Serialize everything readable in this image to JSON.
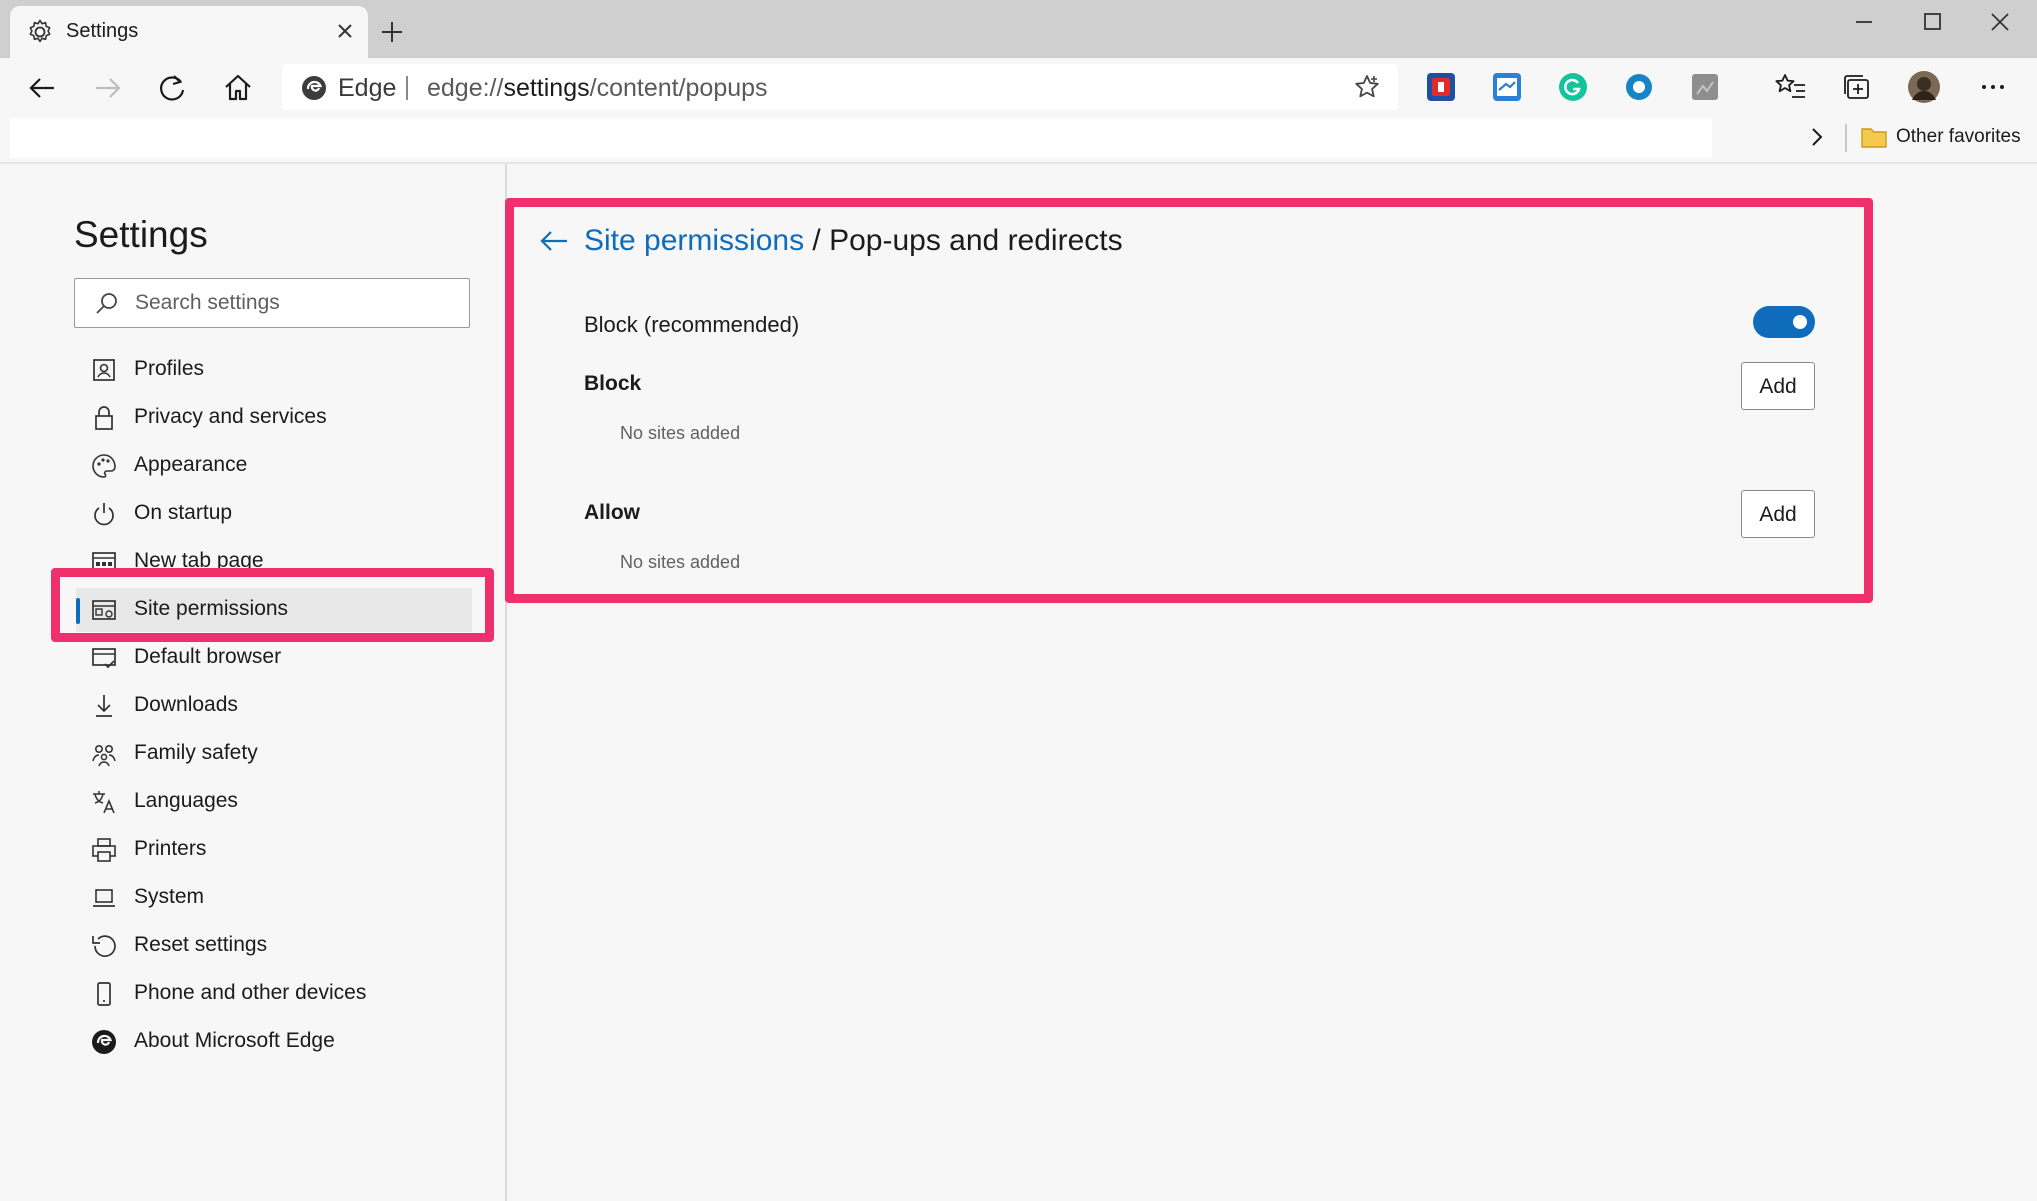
{
  "browser": {
    "tab_title": "Settings",
    "address_site": "Edge",
    "address_url_prefix": "edge://",
    "address_url_host": "settings",
    "address_url_path": "/content/popups",
    "favorites_folder_label": "Other favorites"
  },
  "sidebar": {
    "title": "Settings",
    "search_placeholder": "Search settings",
    "items": [
      {
        "label": "Profiles",
        "icon": "profile-icon"
      },
      {
        "label": "Privacy and services",
        "icon": "lock-icon"
      },
      {
        "label": "Appearance",
        "icon": "palette-icon"
      },
      {
        "label": "On startup",
        "icon": "power-icon"
      },
      {
        "label": "New tab page",
        "icon": "new-tab-icon"
      },
      {
        "label": "Site permissions",
        "icon": "site-permissions-icon",
        "active": true
      },
      {
        "label": "Default browser",
        "icon": "default-browser-icon"
      },
      {
        "label": "Downloads",
        "icon": "download-icon"
      },
      {
        "label": "Family safety",
        "icon": "family-icon"
      },
      {
        "label": "Languages",
        "icon": "languages-icon"
      },
      {
        "label": "Printers",
        "icon": "printer-icon"
      },
      {
        "label": "System",
        "icon": "laptop-icon"
      },
      {
        "label": "Reset settings",
        "icon": "reset-icon"
      },
      {
        "label": "Phone and other devices",
        "icon": "phone-icon"
      },
      {
        "label": "About Microsoft Edge",
        "icon": "edge-logo-icon"
      }
    ]
  },
  "content": {
    "breadcrumb_link": "Site permissions",
    "breadcrumb_separator": "/",
    "breadcrumb_current": "Pop-ups and redirects",
    "block_recommended_label": "Block (recommended)",
    "block_recommended_on": true,
    "block_section_label": "Block",
    "block_empty_text": "No sites added",
    "allow_section_label": "Allow",
    "allow_empty_text": "No sites added",
    "add_button_label": "Add"
  },
  "colors": {
    "accent": "#0f6cbd",
    "highlight": "#f0306c"
  }
}
